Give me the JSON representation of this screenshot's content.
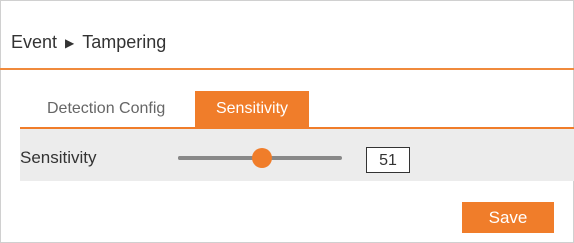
{
  "breadcrumb": {
    "parent": "Event",
    "separator": "▶",
    "current": "Tampering"
  },
  "tabs": [
    {
      "label": "Detection Config",
      "active": false
    },
    {
      "label": "Sensitivity",
      "active": true
    }
  ],
  "sensitivity": {
    "label": "Sensitivity",
    "value": "51",
    "fraction": 0.51
  },
  "actions": {
    "save_label": "Save"
  },
  "colors": {
    "accent": "#f07d2a",
    "panel_bg": "#ececec",
    "track": "#888888"
  }
}
